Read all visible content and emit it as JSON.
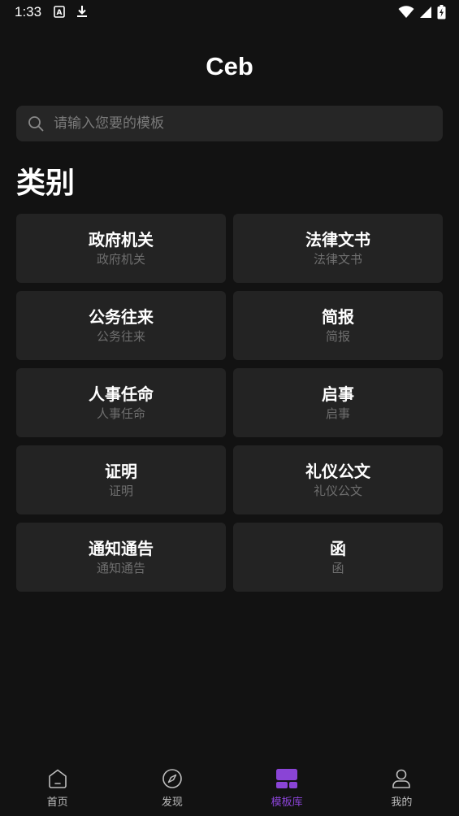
{
  "status_bar": {
    "time": "1:33"
  },
  "header": {
    "title": "Ceb"
  },
  "search": {
    "placeholder": "请输入您要的模板"
  },
  "section": {
    "title": "类别"
  },
  "categories": [
    {
      "title": "政府机关",
      "subtitle": "政府机关"
    },
    {
      "title": "法律文书",
      "subtitle": "法律文书"
    },
    {
      "title": "公务往来",
      "subtitle": "公务往来"
    },
    {
      "title": "简报",
      "subtitle": "简报"
    },
    {
      "title": "人事任命",
      "subtitle": "人事任命"
    },
    {
      "title": "启事",
      "subtitle": "启事"
    },
    {
      "title": "证明",
      "subtitle": "证明"
    },
    {
      "title": "礼仪公文",
      "subtitle": "礼仪公文"
    },
    {
      "title": "通知通告",
      "subtitle": "通知通告"
    },
    {
      "title": "函",
      "subtitle": "函"
    }
  ],
  "bottom_nav": {
    "items": [
      {
        "label": "首页",
        "icon": "home-icon"
      },
      {
        "label": "发现",
        "icon": "compass-icon"
      },
      {
        "label": "模板库",
        "icon": "template-icon",
        "active": true
      },
      {
        "label": "我的",
        "icon": "profile-icon"
      }
    ]
  },
  "colors": {
    "background": "#121212",
    "card": "#232323",
    "accent": "#8a44d6"
  }
}
